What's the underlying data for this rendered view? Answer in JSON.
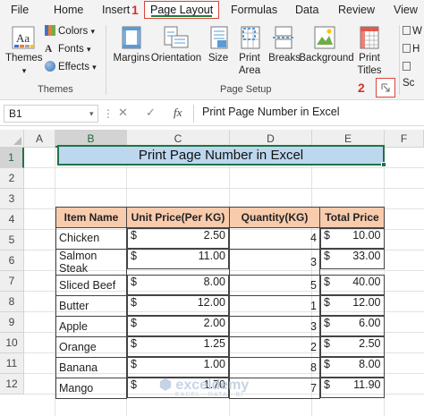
{
  "ribbon": {
    "tabs": [
      "File",
      "Home",
      "Insert",
      "Page Layout",
      "Formulas",
      "Data",
      "Review",
      "View"
    ],
    "active_tab": "Page Layout",
    "step_markers": [
      "1",
      "2"
    ],
    "themes_group": {
      "themes_label": "Themes",
      "colors_label": "Colors",
      "fonts_label": "Fonts",
      "effects_label": "Effects",
      "group_label": "Themes"
    },
    "page_setup_group": {
      "buttons": [
        "Margins",
        "Orientation",
        "Size",
        "Print Area",
        "Breaks",
        "Background",
        "Print Titles"
      ],
      "group_label": "Page Setup"
    },
    "right_truncated": [
      "W",
      "H",
      "Sc"
    ]
  },
  "formula_bar": {
    "name_box": "B1",
    "cancel_glyph": "✕",
    "enter_glyph": "✓",
    "fx_label": "fx",
    "content": "Print Page Number in Excel"
  },
  "sheet": {
    "columns": [
      "A",
      "B",
      "C",
      "D",
      "E",
      "F"
    ],
    "rows": [
      "1",
      "2",
      "3",
      "4",
      "5",
      "6",
      "7",
      "8",
      "9",
      "10",
      "11",
      "12"
    ],
    "selected_cell": "B1",
    "title": "Print Page Number in Excel",
    "table": {
      "headers": [
        "Item Name",
        "Unit Price(Per KG)",
        "Quantity(KG)",
        "Total Price"
      ],
      "currency": "$",
      "rows": [
        {
          "name": "Chicken",
          "price": "2.50",
          "qty": "4",
          "total": "10.00"
        },
        {
          "name": "Salmon Steak",
          "price": "11.00",
          "qty": "3",
          "total": "33.00"
        },
        {
          "name": "Sliced Beef",
          "price": "8.00",
          "qty": "5",
          "total": "40.00"
        },
        {
          "name": "Butter",
          "price": "12.00",
          "qty": "1",
          "total": "12.00"
        },
        {
          "name": "Apple",
          "price": "2.00",
          "qty": "3",
          "total": "6.00"
        },
        {
          "name": "Orange",
          "price": "1.25",
          "qty": "2",
          "total": "2.50"
        },
        {
          "name": "Banana",
          "price": "1.00",
          "qty": "8",
          "total": "8.00"
        },
        {
          "name": "Mango",
          "price": "1.70",
          "qty": "7",
          "total": "11.90"
        }
      ]
    },
    "watermark": {
      "brand": "exceldemy",
      "tagline": "EXCEL · DATA · BI"
    }
  },
  "colors": {
    "excel_green": "#217346",
    "highlight_red": "#e0413a",
    "title_fill": "#bdd7ee",
    "header_fill": "#f8cbad"
  }
}
